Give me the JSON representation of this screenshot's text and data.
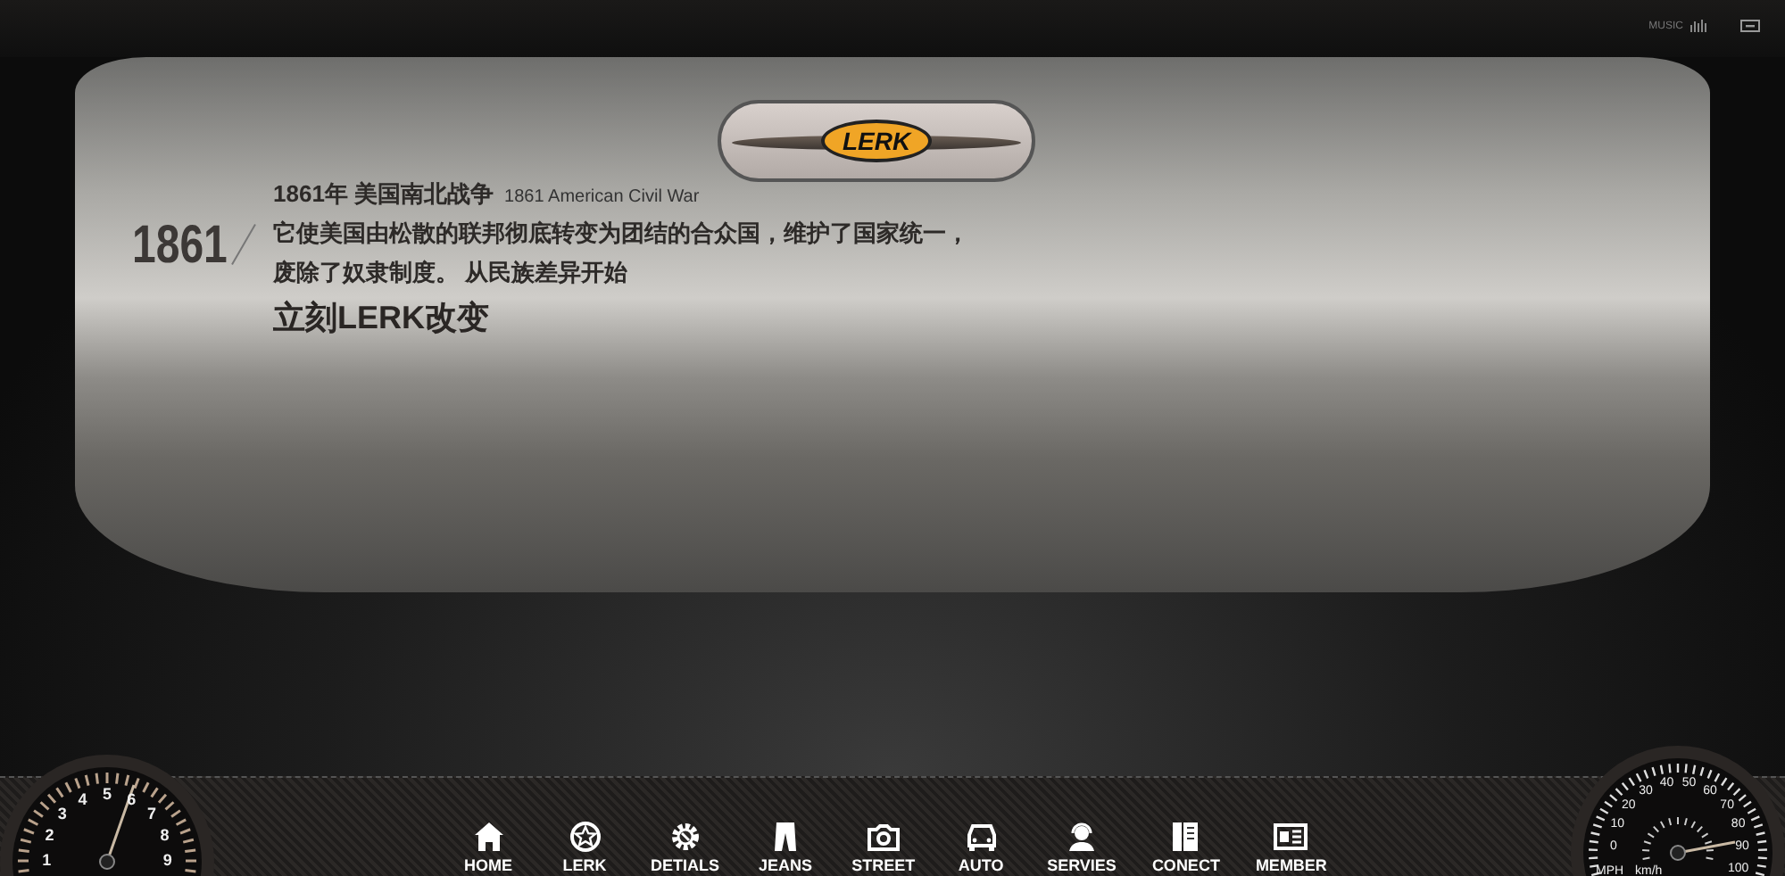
{
  "top_bar": {
    "music_label": "MUSIC"
  },
  "mirror": {
    "logo": "LERK"
  },
  "story": {
    "year": "1861",
    "title_cn": "1861年 美国南北战争",
    "title_en": "1861  American Civil War",
    "body_lines": [
      "它使美国由松散的联邦彻底转变为团结的合众国，维护了国家统一，",
      "废除了奴隶制度。 从民族差异开始"
    ],
    "slogan": "立刻LERK改变"
  },
  "nav": [
    {
      "kind": "home",
      "label": "HOME"
    },
    {
      "kind": "wheel",
      "label": "LERK"
    },
    {
      "kind": "gear",
      "label": "DETIALS"
    },
    {
      "kind": "jeans",
      "label": "JEANS"
    },
    {
      "kind": "camera",
      "label": "STREET"
    },
    {
      "kind": "car",
      "label": "AUTO"
    },
    {
      "kind": "agent",
      "label": "SERVIES"
    },
    {
      "kind": "book",
      "label": "CONECT"
    },
    {
      "kind": "card",
      "label": "MEMBER"
    }
  ],
  "tachometer": {
    "numbers": [
      "1",
      "2",
      "3",
      "4",
      "5",
      "6",
      "7",
      "8",
      "9"
    ]
  },
  "speedometer": {
    "numbers": [
      "0",
      "10",
      "20",
      "30",
      "40",
      "50",
      "60",
      "70",
      "80",
      "90",
      "100"
    ],
    "unit_left": "MPH",
    "unit_right": "km/h"
  }
}
